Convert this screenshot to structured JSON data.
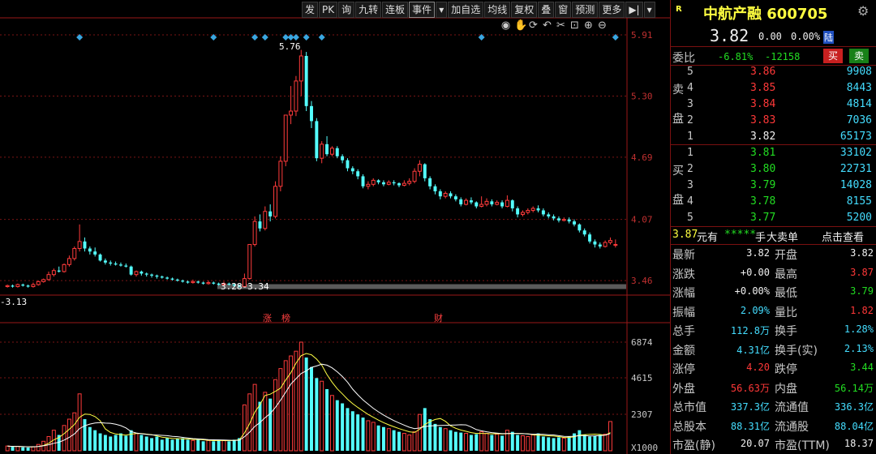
{
  "toolbar": {
    "items": [
      "发",
      "PK",
      "询",
      "九转",
      "连板",
      "事件",
      "▾",
      "加自选",
      "均线",
      "复权",
      "叠",
      "窗",
      "预测",
      "更多"
    ],
    "play_icon": "▶|",
    "menu_icon": "▾"
  },
  "chart_tools": {
    "icons": [
      "eye-icon",
      "hand-icon",
      "refresh-icon",
      "undo-icon",
      "scissors-icon",
      "lock-icon",
      "zoom-in-icon",
      "zoom-out-icon"
    ]
  },
  "price_axis": {
    "ticks": [
      "5.91",
      "5.30",
      "4.69",
      "4.07",
      "3.46"
    ]
  },
  "chart_labels": {
    "high_marker": "5.76",
    "range_label": "3.28-3.34",
    "left_marker": "-3.13",
    "event_zhang": "涨",
    "event_bang": "榜",
    "event_cai": "财"
  },
  "volume_axis": {
    "ticks": [
      "6874",
      "4615",
      "2307"
    ],
    "unit": "X1000"
  },
  "chart_data": {
    "type": "candlestick",
    "price_axis_ticks": [
      5.91,
      5.3,
      4.69,
      4.07,
      3.46
    ],
    "volume_axis_ticks": [
      6874,
      4615,
      2307
    ],
    "volume_unit": "X1000",
    "annotations": [
      "5.76",
      "3.28-3.34",
      "-3.13"
    ],
    "candles": [
      {
        "o": 3.4,
        "c": 3.41,
        "h": 3.42,
        "l": 3.39
      },
      {
        "o": 3.41,
        "c": 3.4,
        "h": 3.42,
        "l": 3.39
      },
      {
        "o": 3.4,
        "c": 3.42,
        "h": 3.43,
        "l": 3.39
      },
      {
        "o": 3.42,
        "c": 3.41,
        "h": 3.43,
        "l": 3.4
      },
      {
        "o": 3.41,
        "c": 3.4,
        "h": 3.42,
        "l": 3.39
      },
      {
        "o": 3.4,
        "c": 3.42,
        "h": 3.44,
        "l": 3.39
      },
      {
        "o": 3.42,
        "c": 3.45,
        "h": 3.46,
        "l": 3.41
      },
      {
        "o": 3.45,
        "c": 3.47,
        "h": 3.48,
        "l": 3.44
      },
      {
        "o": 3.47,
        "c": 3.52,
        "h": 3.55,
        "l": 3.46
      },
      {
        "o": 3.52,
        "c": 3.56,
        "h": 3.58,
        "l": 3.5
      },
      {
        "o": 3.56,
        "c": 3.55,
        "h": 3.6,
        "l": 3.54
      },
      {
        "o": 3.55,
        "c": 3.62,
        "h": 3.63,
        "l": 3.54
      },
      {
        "o": 3.62,
        "c": 3.68,
        "h": 3.71,
        "l": 3.6
      },
      {
        "o": 3.68,
        "c": 3.78,
        "h": 3.8,
        "l": 3.66
      },
      {
        "o": 3.78,
        "c": 3.85,
        "h": 4.02,
        "l": 3.75
      },
      {
        "o": 3.85,
        "c": 3.78,
        "h": 3.89,
        "l": 3.75
      },
      {
        "o": 3.78,
        "c": 3.75,
        "h": 3.8,
        "l": 3.72
      },
      {
        "o": 3.75,
        "c": 3.72,
        "h": 3.79,
        "l": 3.7
      },
      {
        "o": 3.72,
        "c": 3.66,
        "h": 3.73,
        "l": 3.65
      },
      {
        "o": 3.66,
        "c": 3.64,
        "h": 3.68,
        "l": 3.62
      },
      {
        "o": 3.64,
        "c": 3.63,
        "h": 3.66,
        "l": 3.61
      },
      {
        "o": 3.63,
        "c": 3.62,
        "h": 3.65,
        "l": 3.61
      },
      {
        "o": 3.62,
        "c": 3.61,
        "h": 3.64,
        "l": 3.6
      },
      {
        "o": 3.61,
        "c": 3.6,
        "h": 3.63,
        "l": 3.59
      },
      {
        "o": 3.6,
        "c": 3.52,
        "h": 3.61,
        "l": 3.51
      },
      {
        "o": 3.52,
        "c": 3.55,
        "h": 3.56,
        "l": 3.5
      },
      {
        "o": 3.55,
        "c": 3.53,
        "h": 3.56,
        "l": 3.51
      },
      {
        "o": 3.53,
        "c": 3.52,
        "h": 3.54,
        "l": 3.5
      },
      {
        "o": 3.52,
        "c": 3.51,
        "h": 3.53,
        "l": 3.49
      },
      {
        "o": 3.51,
        "c": 3.5,
        "h": 3.52,
        "l": 3.48
      },
      {
        "o": 3.5,
        "c": 3.49,
        "h": 3.51,
        "l": 3.48
      },
      {
        "o": 3.49,
        "c": 3.48,
        "h": 3.5,
        "l": 3.47
      },
      {
        "o": 3.48,
        "c": 3.47,
        "h": 3.49,
        "l": 3.46
      },
      {
        "o": 3.47,
        "c": 3.46,
        "h": 3.48,
        "l": 3.45
      },
      {
        "o": 3.46,
        "c": 3.45,
        "h": 3.47,
        "l": 3.44
      },
      {
        "o": 3.45,
        "c": 3.44,
        "h": 3.46,
        "l": 3.43
      },
      {
        "o": 3.44,
        "c": 3.45,
        "h": 3.47,
        "l": 3.43
      },
      {
        "o": 3.45,
        "c": 3.44,
        "h": 3.46,
        "l": 3.43
      },
      {
        "o": 3.44,
        "c": 3.43,
        "h": 3.45,
        "l": 3.42
      },
      {
        "o": 3.43,
        "c": 3.44,
        "h": 3.46,
        "l": 3.42
      },
      {
        "o": 3.44,
        "c": 3.43,
        "h": 3.45,
        "l": 3.42
      },
      {
        "o": 3.43,
        "c": 3.42,
        "h": 3.44,
        "l": 3.41
      },
      {
        "o": 3.42,
        "c": 3.43,
        "h": 3.45,
        "l": 3.41
      },
      {
        "o": 3.43,
        "c": 3.42,
        "h": 3.44,
        "l": 3.41
      },
      {
        "o": 3.42,
        "c": 3.41,
        "h": 3.43,
        "l": 3.4
      },
      {
        "o": 3.41,
        "c": 3.4,
        "h": 3.42,
        "l": 3.39
      },
      {
        "o": 3.4,
        "c": 3.48,
        "h": 3.53,
        "l": 3.39
      },
      {
        "o": 3.48,
        "c": 3.82,
        "h": 3.82,
        "l": 3.47
      },
      {
        "o": 3.82,
        "c": 4.05,
        "h": 4.1,
        "l": 3.8
      },
      {
        "o": 4.05,
        "c": 3.98,
        "h": 4.12,
        "l": 3.95
      },
      {
        "o": 3.98,
        "c": 4.15,
        "h": 4.2,
        "l": 3.96
      },
      {
        "o": 4.15,
        "c": 4.1,
        "h": 4.22,
        "l": 4.05
      },
      {
        "o": 4.1,
        "c": 4.4,
        "h": 4.45,
        "l": 4.08
      },
      {
        "o": 4.4,
        "c": 4.65,
        "h": 4.7,
        "l": 4.35
      },
      {
        "o": 4.65,
        "c": 5.11,
        "h": 5.11,
        "l": 4.6
      },
      {
        "o": 5.11,
        "c": 5.15,
        "h": 5.4,
        "l": 5.02
      },
      {
        "o": 5.15,
        "c": 5.45,
        "h": 5.5,
        "l": 5.1
      },
      {
        "o": 5.45,
        "c": 5.7,
        "h": 5.76,
        "l": 5.3
      },
      {
        "o": 5.7,
        "c": 5.2,
        "h": 5.74,
        "l": 5.15
      },
      {
        "o": 5.2,
        "c": 5.05,
        "h": 5.25,
        "l": 4.98
      },
      {
        "o": 5.05,
        "c": 4.68,
        "h": 5.08,
        "l": 4.65
      },
      {
        "o": 4.68,
        "c": 4.82,
        "h": 4.85,
        "l": 4.63
      },
      {
        "o": 4.82,
        "c": 4.72,
        "h": 4.9,
        "l": 4.7
      },
      {
        "o": 4.72,
        "c": 4.78,
        "h": 4.8,
        "l": 4.7
      },
      {
        "o": 4.78,
        "c": 4.7,
        "h": 4.8,
        "l": 4.68
      },
      {
        "o": 4.7,
        "c": 4.66,
        "h": 4.72,
        "l": 4.63
      },
      {
        "o": 4.66,
        "c": 4.58,
        "h": 4.68,
        "l": 4.55
      },
      {
        "o": 4.58,
        "c": 4.55,
        "h": 4.6,
        "l": 4.52
      },
      {
        "o": 4.55,
        "c": 4.5,
        "h": 4.57,
        "l": 4.47
      },
      {
        "o": 4.5,
        "c": 4.4,
        "h": 4.52,
        "l": 4.38
      },
      {
        "o": 4.4,
        "c": 4.42,
        "h": 4.45,
        "l": 4.37
      },
      {
        "o": 4.42,
        "c": 4.46,
        "h": 4.48,
        "l": 4.4
      },
      {
        "o": 4.46,
        "c": 4.44,
        "h": 4.47,
        "l": 4.42
      },
      {
        "o": 4.44,
        "c": 4.42,
        "h": 4.46,
        "l": 4.4
      },
      {
        "o": 4.42,
        "c": 4.44,
        "h": 4.46,
        "l": 4.41
      },
      {
        "o": 4.44,
        "c": 4.43,
        "h": 4.46,
        "l": 4.41
      },
      {
        "o": 4.43,
        "c": 4.41,
        "h": 4.44,
        "l": 4.39
      },
      {
        "o": 4.41,
        "c": 4.43,
        "h": 4.46,
        "l": 4.4
      },
      {
        "o": 4.43,
        "c": 4.45,
        "h": 4.48,
        "l": 4.41
      },
      {
        "o": 4.45,
        "c": 4.55,
        "h": 4.58,
        "l": 4.43
      },
      {
        "o": 4.55,
        "c": 4.62,
        "h": 4.66,
        "l": 4.5
      },
      {
        "o": 4.62,
        "c": 4.48,
        "h": 4.63,
        "l": 4.45
      },
      {
        "o": 4.48,
        "c": 4.4,
        "h": 4.5,
        "l": 4.37
      },
      {
        "o": 4.4,
        "c": 4.35,
        "h": 4.42,
        "l": 4.32
      },
      {
        "o": 4.35,
        "c": 4.3,
        "h": 4.37,
        "l": 4.27
      },
      {
        "o": 4.3,
        "c": 4.33,
        "h": 4.35,
        "l": 4.28
      },
      {
        "o": 4.33,
        "c": 4.3,
        "h": 4.35,
        "l": 4.28
      },
      {
        "o": 4.3,
        "c": 4.27,
        "h": 4.32,
        "l": 4.25
      },
      {
        "o": 4.27,
        "c": 4.22,
        "h": 4.29,
        "l": 4.2
      },
      {
        "o": 4.22,
        "c": 4.26,
        "h": 4.28,
        "l": 4.21
      },
      {
        "o": 4.26,
        "c": 4.24,
        "h": 4.29,
        "l": 4.22
      },
      {
        "o": 4.24,
        "c": 4.2,
        "h": 4.25,
        "l": 4.18
      },
      {
        "o": 4.2,
        "c": 4.22,
        "h": 4.3,
        "l": 4.19
      },
      {
        "o": 4.22,
        "c": 4.25,
        "h": 4.28,
        "l": 4.2
      },
      {
        "o": 4.25,
        "c": 4.22,
        "h": 4.27,
        "l": 4.2
      },
      {
        "o": 4.22,
        "c": 4.24,
        "h": 4.26,
        "l": 4.21
      },
      {
        "o": 4.24,
        "c": 4.2,
        "h": 4.26,
        "l": 4.18
      },
      {
        "o": 4.2,
        "c": 4.26,
        "h": 4.31,
        "l": 4.19
      },
      {
        "o": 4.26,
        "c": 4.18,
        "h": 4.27,
        "l": 4.15
      },
      {
        "o": 4.18,
        "c": 4.12,
        "h": 4.2,
        "l": 4.09
      },
      {
        "o": 4.12,
        "c": 4.14,
        "h": 4.16,
        "l": 4.1
      },
      {
        "o": 4.14,
        "c": 4.16,
        "h": 4.18,
        "l": 4.12
      },
      {
        "o": 4.16,
        "c": 4.18,
        "h": 4.2,
        "l": 4.14
      },
      {
        "o": 4.18,
        "c": 4.16,
        "h": 4.21,
        "l": 4.14
      },
      {
        "o": 4.16,
        "c": 4.12,
        "h": 4.18,
        "l": 4.1
      },
      {
        "o": 4.12,
        "c": 4.1,
        "h": 4.14,
        "l": 4.08
      },
      {
        "o": 4.1,
        "c": 4.08,
        "h": 4.12,
        "l": 4.06
      },
      {
        "o": 4.08,
        "c": 4.06,
        "h": 4.1,
        "l": 4.04
      },
      {
        "o": 4.06,
        "c": 4.07,
        "h": 4.09,
        "l": 4.05
      },
      {
        "o": 4.07,
        "c": 4.05,
        "h": 4.09,
        "l": 4.03
      },
      {
        "o": 4.05,
        "c": 4.02,
        "h": 4.07,
        "l": 4.0
      },
      {
        "o": 4.02,
        "c": 3.96,
        "h": 4.03,
        "l": 3.94
      },
      {
        "o": 3.96,
        "c": 3.92,
        "h": 3.98,
        "l": 3.9
      },
      {
        "o": 3.92,
        "c": 3.85,
        "h": 3.94,
        "l": 3.83
      },
      {
        "o": 3.85,
        "c": 3.82,
        "h": 3.87,
        "l": 3.79
      },
      {
        "o": 3.82,
        "c": 3.8,
        "h": 3.84,
        "l": 3.78
      },
      {
        "o": 3.8,
        "c": 3.84,
        "h": 3.86,
        "l": 3.79
      },
      {
        "o": 3.84,
        "c": 3.86,
        "h": 3.89,
        "l": 3.82
      },
      {
        "o": 3.82,
        "c": 3.82,
        "h": 3.87,
        "l": 3.79
      }
    ],
    "volume": [
      300,
      250,
      280,
      220,
      200,
      260,
      400,
      600,
      900,
      1300,
      1000,
      1600,
      2000,
      2400,
      3600,
      2000,
      1500,
      1300,
      1100,
      1000,
      900,
      1000,
      1100,
      950,
      1300,
      1100,
      1000,
      900,
      800,
      900,
      700,
      800,
      700,
      750,
      800,
      700,
      650,
      700,
      600,
      650,
      600,
      700,
      650,
      600,
      700,
      800,
      2900,
      3600,
      4200,
      3100,
      3700,
      3300,
      4500,
      5200,
      5700,
      6000,
      6300,
      6874,
      5900,
      5300,
      4600,
      4400,
      3900,
      3500,
      3200,
      3000,
      2700,
      2500,
      2300,
      2100,
      1900,
      1800,
      1600,
      1500,
      1400,
      1300,
      1200,
      1100,
      1000,
      1200,
      2300,
      2700,
      2000,
      1700,
      1500,
      1400,
      1300,
      1200,
      1150,
      1100,
      1000,
      1050,
      1200,
      1100,
      1000,
      1050,
      950,
      1300,
      1200,
      1000,
      950,
      900,
      1000,
      1100,
      900,
      850,
      800,
      850,
      800,
      900,
      1100,
      1300,
      1000,
      900,
      950,
      1000,
      1050,
      1850
    ]
  },
  "panel": {
    "r_label": "R",
    "stock_name": "中航产融 600705",
    "gear_icon": "gear-icon",
    "price": "3.82",
    "change": "0.00",
    "change_pct": "0.00%",
    "lu_badge": "陆",
    "weibi_label": "委比",
    "weibi_value": "-6.81%",
    "weicha_value": "-12158",
    "buy_btn": "买",
    "sell_btn": "卖",
    "sell_side_chars": [
      "卖",
      "盘"
    ],
    "buy_side_chars": [
      "买",
      "盘"
    ],
    "asks": [
      {
        "level": "5",
        "price": "3.86",
        "vol": "9908"
      },
      {
        "level": "4",
        "price": "3.85",
        "vol": "8443"
      },
      {
        "level": "3",
        "price": "3.84",
        "vol": "4814"
      },
      {
        "level": "2",
        "price": "3.83",
        "vol": "7036"
      },
      {
        "level": "1",
        "price": "3.82",
        "vol": "65173"
      }
    ],
    "bids": [
      {
        "level": "1",
        "price": "3.81",
        "vol": "33102"
      },
      {
        "level": "2",
        "price": "3.80",
        "vol": "22731"
      },
      {
        "level": "3",
        "price": "3.79",
        "vol": "14028"
      },
      {
        "level": "4",
        "price": "3.78",
        "vol": "8155"
      },
      {
        "level": "5",
        "price": "3.77",
        "vol": "5200"
      }
    ],
    "notice": {
      "price": "3.87",
      "unit_a": "元有",
      "stars": "*****",
      "unit_b": "手",
      "big_sell": "大卖单",
      "link": "点击查看"
    },
    "stats": [
      {
        "l1": "最新",
        "v1": "3.82",
        "c1": "white",
        "l2": "开盘",
        "v2": "3.82",
        "c2": "white"
      },
      {
        "l1": "涨跌",
        "v1": "+0.00",
        "c1": "white",
        "l2": "最高",
        "v2": "3.87",
        "c2": "red"
      },
      {
        "l1": "涨幅",
        "v1": "+0.00%",
        "c1": "white",
        "l2": "最低",
        "v2": "3.79",
        "c2": "green"
      },
      {
        "l1": "振幅",
        "v1": "2.09%",
        "c1": "cyan",
        "l2": "量比",
        "v2": "1.82",
        "c2": "red"
      },
      {
        "l1": "总手",
        "v1": "112.8万",
        "c1": "cyan",
        "l2": "换手",
        "v2": "1.28%",
        "c2": "cyan"
      },
      {
        "l1": "金额",
        "v1": "4.31亿",
        "c1": "cyan",
        "l2": "换手(实)",
        "v2": "2.13%",
        "c2": "cyan"
      },
      {
        "l1": "涨停",
        "v1": "4.20",
        "c1": "red",
        "l2": "跌停",
        "v2": "3.44",
        "c2": "green"
      },
      {
        "l1": "外盘",
        "v1": "56.63万",
        "c1": "red",
        "l2": "内盘",
        "v2": "56.14万",
        "c2": "green"
      },
      {
        "l1": "总市值",
        "v1": "337.3亿",
        "c1": "cyan",
        "l2": "流通值",
        "v2": "336.3亿",
        "c2": "cyan"
      },
      {
        "l1": "总股本",
        "v1": "88.31亿",
        "c1": "cyan",
        "l2": "流通股",
        "v2": "88.04亿",
        "c2": "cyan"
      },
      {
        "l1": "市盈(静)",
        "v1": "20.07",
        "c1": "white",
        "l2": "市盈(TTM)",
        "v2": "18.37",
        "c2": "white"
      }
    ]
  },
  "colors": {
    "up": "#ff3b3b",
    "down": "#54ffff",
    "grid": "#7a1515",
    "ma5": "#ffff44",
    "ma10": "#ffffff",
    "event_marker": "#3aa6e0"
  }
}
